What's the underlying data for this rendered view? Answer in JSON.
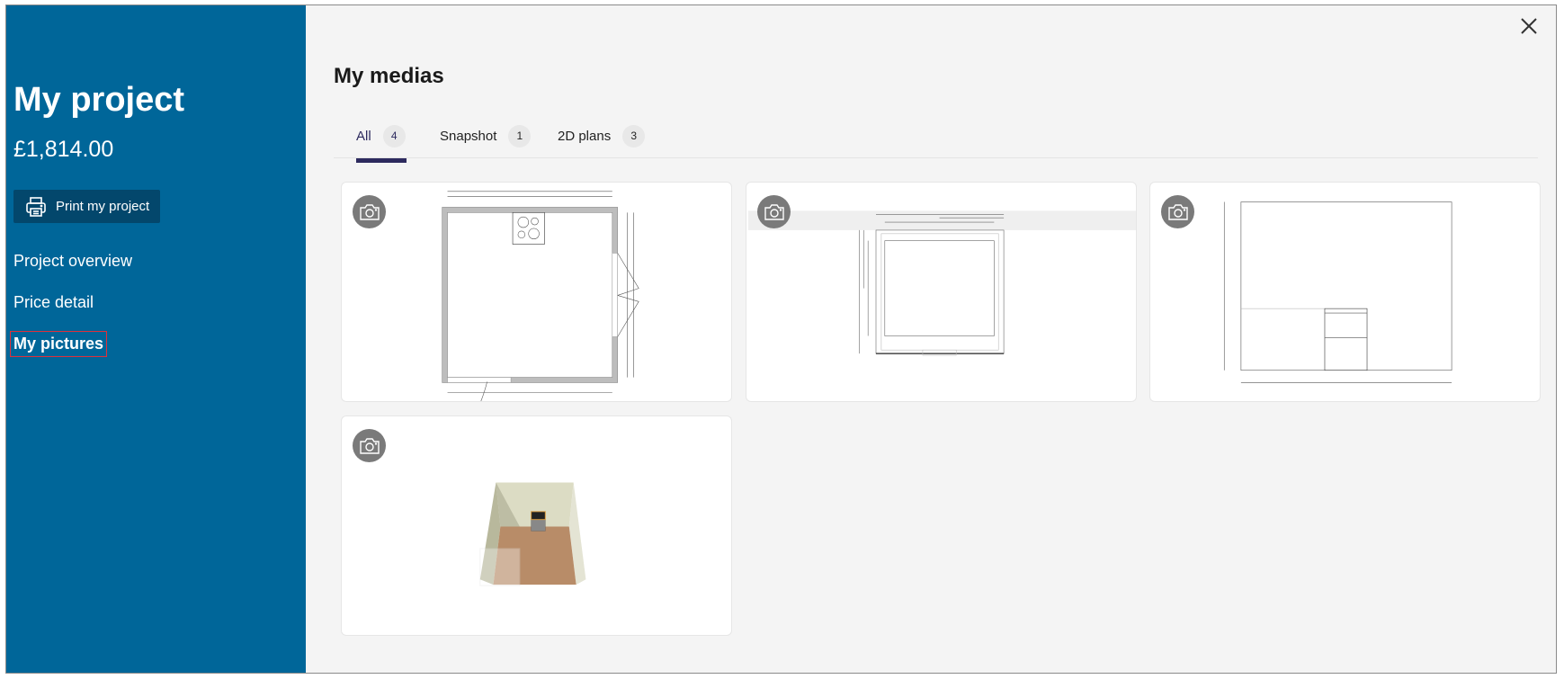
{
  "sidebar": {
    "title": "My project",
    "price": "£1,814.00",
    "print_label": "Print my project",
    "nav": [
      {
        "label": "Project overview"
      },
      {
        "label": "Price detail"
      },
      {
        "label": "My pictures",
        "active": true
      }
    ]
  },
  "main": {
    "heading": "My medias",
    "tabs": [
      {
        "label": "All",
        "count": "4",
        "active": true
      },
      {
        "label": "Snapshot",
        "count": "1"
      },
      {
        "label": "2D plans",
        "count": "3"
      }
    ],
    "medias": [
      {
        "type": "2D plan",
        "icon": "camera-icon"
      },
      {
        "type": "2D plan",
        "icon": "camera-icon"
      },
      {
        "type": "2D plan",
        "icon": "camera-icon"
      },
      {
        "type": "Snapshot",
        "icon": "camera-icon"
      }
    ]
  },
  "colors": {
    "sidebar": "#006699",
    "button": "#03476c",
    "tab_accent": "#2d2a5e",
    "active_outline": "#e0303a"
  }
}
